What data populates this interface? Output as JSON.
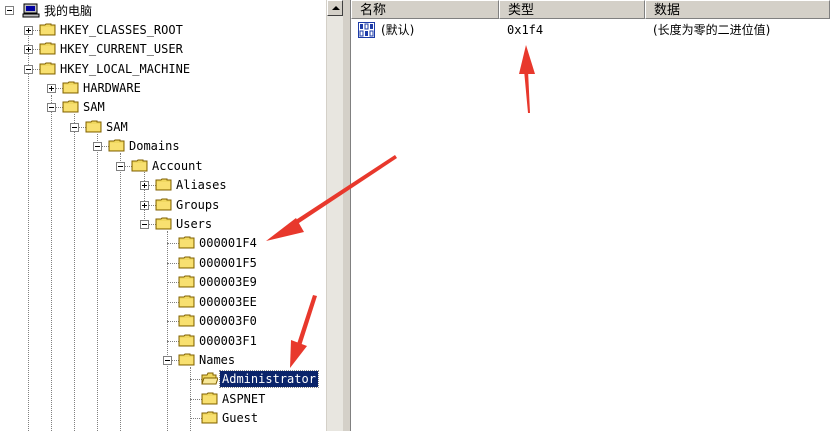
{
  "tree": {
    "root": "我的电脑",
    "nodes": [
      {
        "label": "HKEY_CLASSES_ROOT"
      },
      {
        "label": "HKEY_CURRENT_USER"
      },
      {
        "label": "HKEY_LOCAL_MACHINE"
      },
      {
        "label": "HARDWARE"
      },
      {
        "label": "SAM"
      },
      {
        "label": "SAM"
      },
      {
        "label": "Domains"
      },
      {
        "label": "Account"
      },
      {
        "label": "Aliases"
      },
      {
        "label": "Groups"
      },
      {
        "label": "Users"
      },
      {
        "label": "000001F4"
      },
      {
        "label": "000001F5"
      },
      {
        "label": "000003E9"
      },
      {
        "label": "000003EE"
      },
      {
        "label": "000003F0"
      },
      {
        "label": "000003F1"
      },
      {
        "label": "Names"
      },
      {
        "label": "Administrator"
      },
      {
        "label": "ASPNET"
      },
      {
        "label": "Guest"
      }
    ]
  },
  "list": {
    "columns": [
      "名称",
      "类型",
      "数据"
    ],
    "rows": [
      {
        "name": "(默认)",
        "type": "0x1f4",
        "data": "(长度为零的二进位值)"
      }
    ]
  },
  "colors": {
    "selection": "#0a246a",
    "arrow": "#e8382c",
    "folder": "#f0d860"
  }
}
